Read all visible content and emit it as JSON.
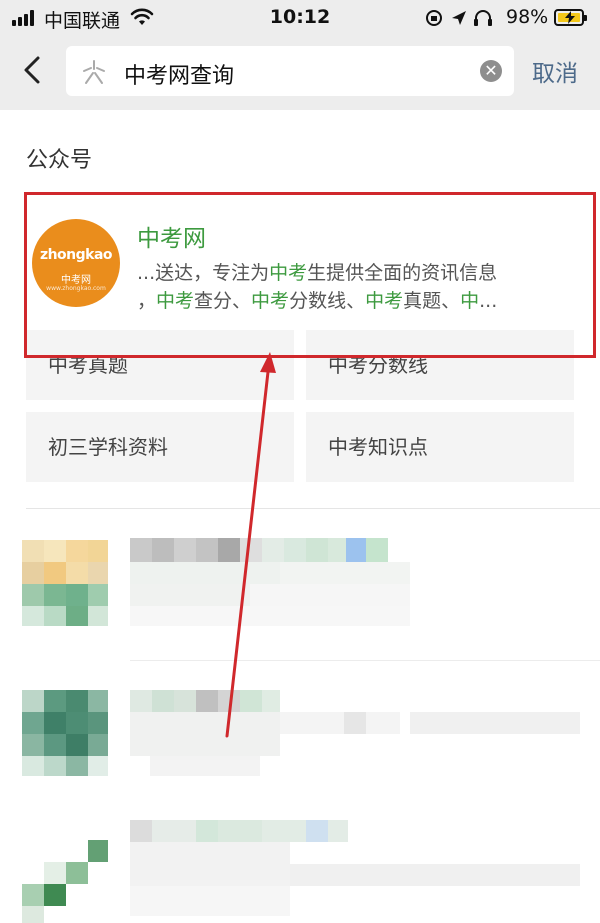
{
  "status_bar": {
    "carrier": "中国联通",
    "time": "10:12",
    "battery_percent": "98%",
    "signal_icon": "signal-bars-icon",
    "wifi_icon": "wifi-icon",
    "battery_icon": "battery-charging-icon"
  },
  "search": {
    "query": "中考网查询",
    "cancel_label": "取消",
    "app_icon": "search-logo-icon",
    "clear_icon": "clear-icon"
  },
  "section": {
    "title": "公众号"
  },
  "account": {
    "name": "中考网",
    "avatar_brand": "zhongkao",
    "avatar_cn": "中考网",
    "avatar_url": "www.zhongkao.com",
    "desc_line1_pre": "...送达，专注为",
    "desc_line1_hl": "中考",
    "desc_line1_post": "生提供全面的资讯信息",
    "desc_line2_1": "，",
    "desc_line2_hl1": "中考",
    "desc_line2_2": "查分、",
    "desc_line2_hl2": "中考",
    "desc_line2_3": "分数线、",
    "desc_line2_hl3": "中考",
    "desc_line2_4": "真题、",
    "desc_line2_hl4": "中",
    "desc_line2_5": "...",
    "highlight_color": "#3d9a3f"
  },
  "menu": [
    {
      "label": "中考真题"
    },
    {
      "label": "中考分数线"
    },
    {
      "label": "初三学科资料"
    },
    {
      "label": "中考知识点"
    }
  ],
  "colors": {
    "annotation_red": "#d0282c",
    "cancel_blue": "#4d6a8a"
  }
}
